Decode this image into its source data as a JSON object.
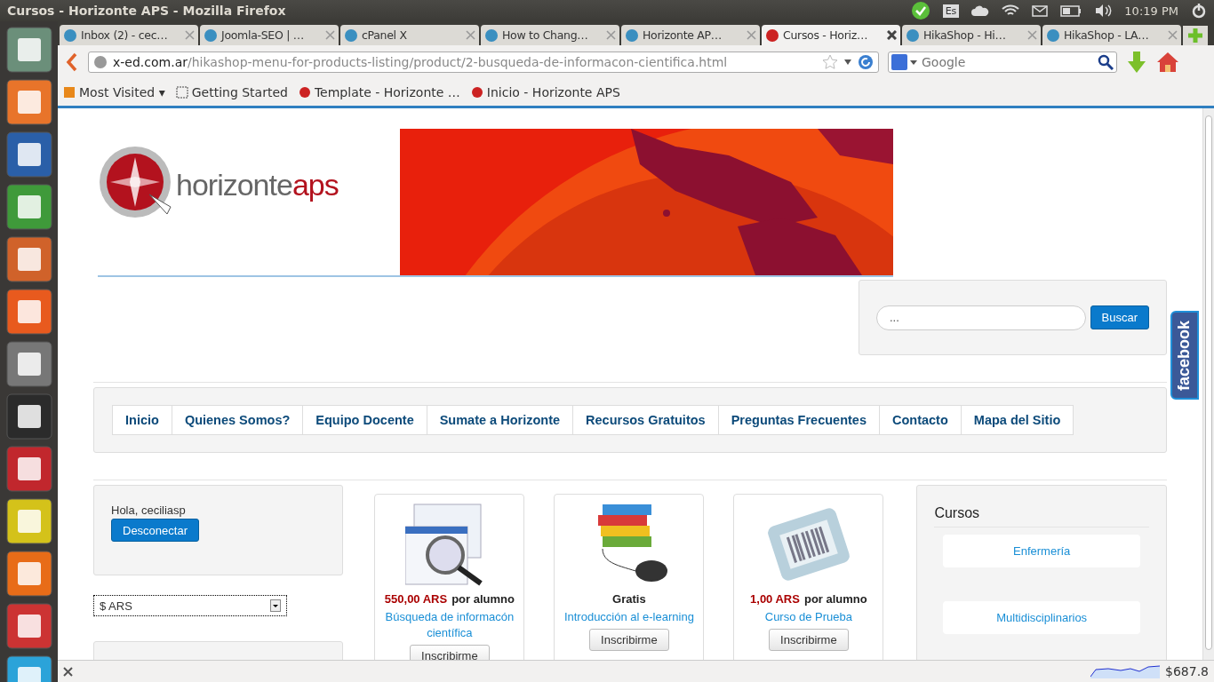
{
  "window": {
    "title": "Cursos - Horizonte APS - Mozilla Firefox"
  },
  "top_panel": {
    "keyboard_layout": "Es",
    "clock": "10:19 PM"
  },
  "tabs": [
    {
      "label": "Inbox (2) - cec…",
      "selected": false
    },
    {
      "label": "Joomla-SEO | …",
      "selected": false
    },
    {
      "label": "cPanel X",
      "selected": false
    },
    {
      "label": "How to Chang…",
      "selected": false
    },
    {
      "label": "Horizonte AP…",
      "selected": false
    },
    {
      "label": "Cursos - Horiz…",
      "selected": true
    },
    {
      "label": "HikaShop - Hi…",
      "selected": false
    },
    {
      "label": "HikaShop - LA…",
      "selected": false
    }
  ],
  "address_bar": {
    "domain": "x-ed.com.ar",
    "path": "/hikashop-menu-for-products-listing/product/2-busqueda-de-informacon-cientifica.html"
  },
  "search_bar": {
    "placeholder": "Google"
  },
  "bookmarks": [
    {
      "label": "Most Visited ▾"
    },
    {
      "label": "Getting Started"
    },
    {
      "label": "Template - Horizonte …"
    },
    {
      "label": "Inicio - Horizonte APS"
    }
  ],
  "page": {
    "logo": {
      "text_a": "horizonte",
      "text_b": "aps"
    },
    "search": {
      "placeholder": "...",
      "button": "Buscar"
    },
    "menu": [
      "Inicio",
      "Quienes Somos?",
      "Equipo Docente",
      "Sumate a Horizonte",
      "Recursos Gratuitos",
      "Preguntas Frecuentes",
      "Contacto",
      "Mapa del Sitio"
    ],
    "login": {
      "greeting": "Hola, ceciliasp",
      "button": "Desconectar"
    },
    "currency": {
      "value": "$ ARS"
    },
    "products": [
      {
        "price": "550,00 ARS",
        "unit": "por alumno",
        "title": "Búsqueda de informacón científica",
        "button": "Inscribirme"
      },
      {
        "price": "Gratis",
        "title": "Introducción al e-learning",
        "button": "Inscribirme"
      },
      {
        "price": "1,00 ARS",
        "unit": "por alumno",
        "title": "Curso de Prueba",
        "button": "Inscribirme"
      }
    ],
    "courses": {
      "title": "Cursos",
      "items": [
        "Enfermería",
        "Multidisciplinarios"
      ]
    },
    "facebook_tab": "facebook"
  },
  "status_bar": {
    "reading": "$687.8"
  }
}
